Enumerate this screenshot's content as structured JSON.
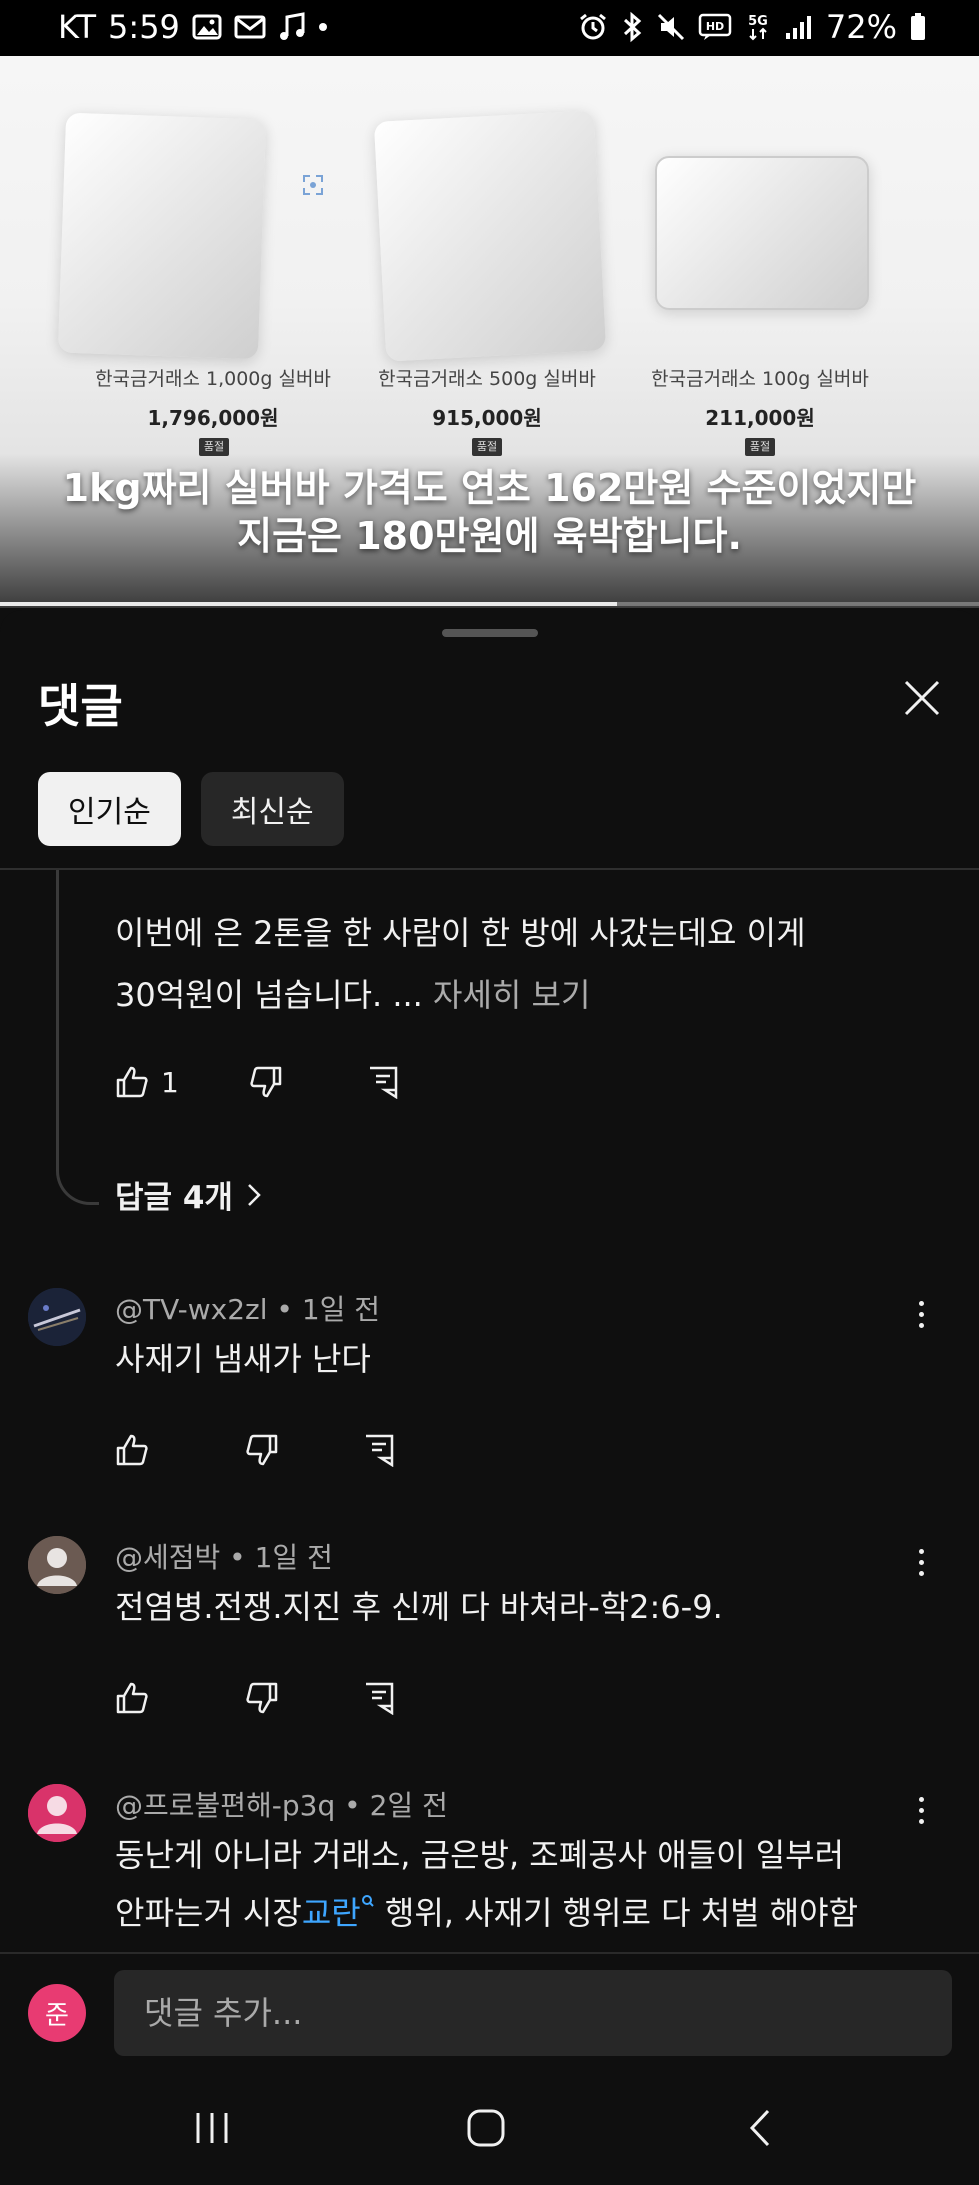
{
  "status_bar": {
    "carrier": "KT",
    "time": "5:59",
    "network": "5G",
    "battery": "72%"
  },
  "video": {
    "products": [
      {
        "name": "한국금거래소 1,000g 실버바",
        "price": "1,796,000원",
        "tag": "품절"
      },
      {
        "name": "한국금거래소 500g 실버바",
        "price": "915,000원",
        "tag": "품절"
      },
      {
        "name": "한국금거래소 100g 실버바",
        "price": "211,000원",
        "tag": "품절"
      }
    ],
    "caption_line1": "1kg짜리 실버바 가격도 연초 162만원 수준이었지만",
    "caption_line2": "지금은 180만원에 육박합니다.",
    "progress": 0.63
  },
  "comments_panel": {
    "title": "댓글",
    "sort_chips": [
      {
        "label": "인기순",
        "active": true
      },
      {
        "label": "최신순",
        "active": false
      }
    ],
    "reply_preview": {
      "text_line1": "이번에 은 2톤을 한 사람이 한 방에 사갔는데요 이게",
      "text_line2": "30억원이 넘습니다. ...",
      "more_label": "자세히 보기",
      "like_count": "1",
      "replies_label": "답글 4개"
    },
    "comments": [
      {
        "author": "@TV-wx2zl",
        "time": "1일 전",
        "text": "사재기 냄새가 난다",
        "avatar_color": "#1e2a44"
      },
      {
        "author": "@세점박",
        "time": "1일 전",
        "text": "전염병.전쟁.지진 후 신께 다 바쳐라-학2:6-9.",
        "avatar_color": "#6b5a52"
      },
      {
        "author": "@프로불편해-p3q",
        "time": "2일 전",
        "text_line1": "동난게 아니라 거래소, 금은방, 조폐공사 애들이 일부러",
        "text_line2_pre": "안파는거 시장",
        "text_line2_link": "교란",
        "text_line2_post": " 행위, 사재기 행위로 다 처벌 해야함",
        "avatar_color": "#d9336a"
      }
    ],
    "input": {
      "user_initial": "준",
      "placeholder": "댓글 추가..."
    }
  }
}
